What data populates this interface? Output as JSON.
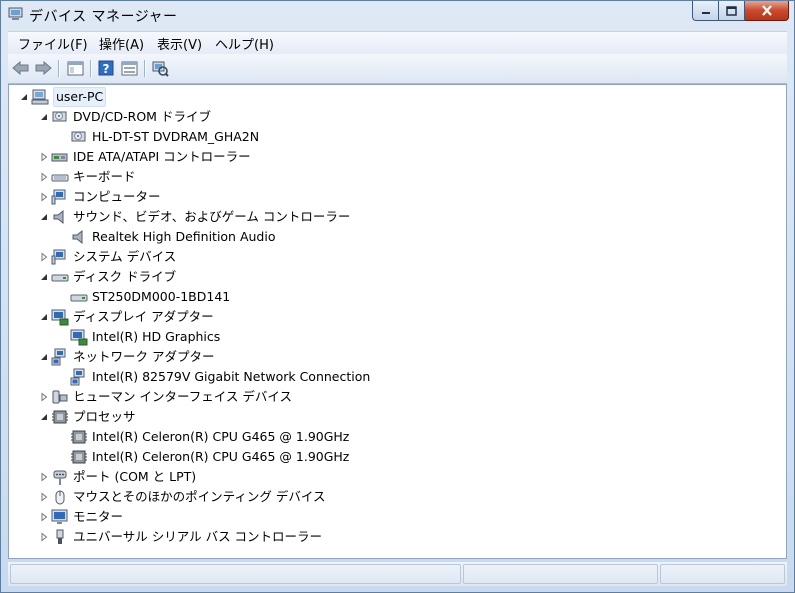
{
  "window": {
    "title": "デバイス マネージャー"
  },
  "menu": [
    "ファイル(F)",
    "操作(A)",
    "表示(V)",
    "ヘルプ(H)"
  ],
  "toolbar": [
    "back-icon",
    "forward-icon",
    "properties-tree-icon",
    "help-icon",
    "details-icon",
    "scan-hardware-icon"
  ],
  "tree": {
    "root": "user-PC",
    "rows": [
      {
        "label": "DVD/CD-ROM ドライブ",
        "expanded": true,
        "icon": "dvd-drive-icon"
      },
      {
        "label": "HL-DT-ST DVDRAM_GHA2N",
        "icon": "dvd-drive-icon"
      },
      {
        "label": "IDE ATA/ATAPI コントローラー",
        "expanded": false,
        "icon": "ide-controller-icon"
      },
      {
        "label": "キーボード",
        "expanded": false,
        "icon": "keyboard-icon"
      },
      {
        "label": "コンピューター",
        "expanded": false,
        "icon": "computer-icon"
      },
      {
        "label": "サウンド、ビデオ、およびゲーム コントローラー",
        "expanded": true,
        "icon": "speaker-icon"
      },
      {
        "label": "Realtek High Definition Audio",
        "icon": "speaker-icon"
      },
      {
        "label": "システム デバイス",
        "expanded": false,
        "icon": "system-device-icon"
      },
      {
        "label": "ディスク ドライブ",
        "expanded": true,
        "icon": "disk-drive-icon"
      },
      {
        "label": "ST250DM000-1BD141",
        "icon": "disk-drive-icon"
      },
      {
        "label": "ディスプレイ アダプター",
        "expanded": true,
        "icon": "display-adapter-icon"
      },
      {
        "label": "Intel(R) HD Graphics",
        "icon": "display-adapter-icon"
      },
      {
        "label": "ネットワーク アダプター",
        "expanded": true,
        "icon": "network-adapter-icon"
      },
      {
        "label": "Intel(R) 82579V Gigabit Network Connection",
        "icon": "network-adapter-icon"
      },
      {
        "label": "ヒューマン インターフェイス デバイス",
        "expanded": false,
        "icon": "hid-icon"
      },
      {
        "label": "プロセッサ",
        "expanded": true,
        "icon": "processor-icon"
      },
      {
        "label": "Intel(R) Celeron(R) CPU G465 @ 1.90GHz",
        "icon": "processor-icon"
      },
      {
        "label": "Intel(R) Celeron(R) CPU G465 @ 1.90GHz",
        "icon": "processor-icon"
      },
      {
        "label": "ポート (COM と LPT)",
        "expanded": false,
        "icon": "port-icon"
      },
      {
        "label": "マウスとそのほかのポインティング デバイス",
        "expanded": false,
        "icon": "mouse-icon"
      },
      {
        "label": "モニター",
        "expanded": false,
        "icon": "monitor-icon"
      },
      {
        "label": "ユニバーサル シリアル バス コントローラー",
        "expanded": false,
        "icon": "usb-icon"
      }
    ]
  },
  "colors": {
    "titlebar": "#c9daee",
    "close_button": "#c94a2d",
    "selection": "#e6f0fa"
  }
}
